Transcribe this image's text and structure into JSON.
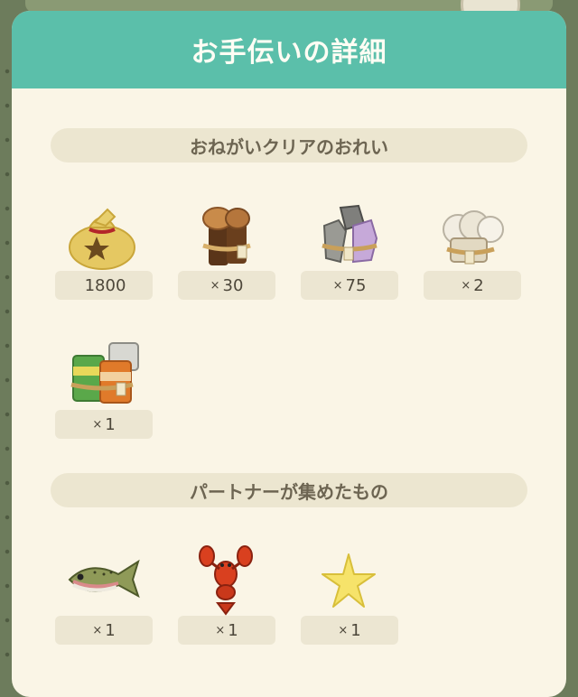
{
  "panel": {
    "title": "お手伝いの詳細"
  },
  "reward_section": {
    "title": "おねがいクリアのおれい",
    "items": [
      {
        "icon": "bell-bag-icon",
        "count": "1800",
        "prefix": ""
      },
      {
        "icon": "wood-bundle-icon",
        "count": "30",
        "prefix": "×"
      },
      {
        "icon": "stone-bundle-icon",
        "count": "75",
        "prefix": "×"
      },
      {
        "icon": "cotton-bundle-icon",
        "count": "2",
        "prefix": "×"
      },
      {
        "icon": "canned-food-bundle-icon",
        "count": "1",
        "prefix": "×"
      }
    ]
  },
  "partner_section": {
    "title": "パートナーが集めたもの",
    "items": [
      {
        "icon": "trout-fish-icon",
        "count": "1",
        "prefix": "×"
      },
      {
        "icon": "lobster-icon",
        "count": "1",
        "prefix": "×"
      },
      {
        "icon": "starfish-icon",
        "count": "1",
        "prefix": "×"
      }
    ]
  },
  "colors": {
    "header": "#5bbfaa",
    "panel": "#faf5e6",
    "badge": "#ece6d2",
    "section_bar": "#ece6d0"
  }
}
